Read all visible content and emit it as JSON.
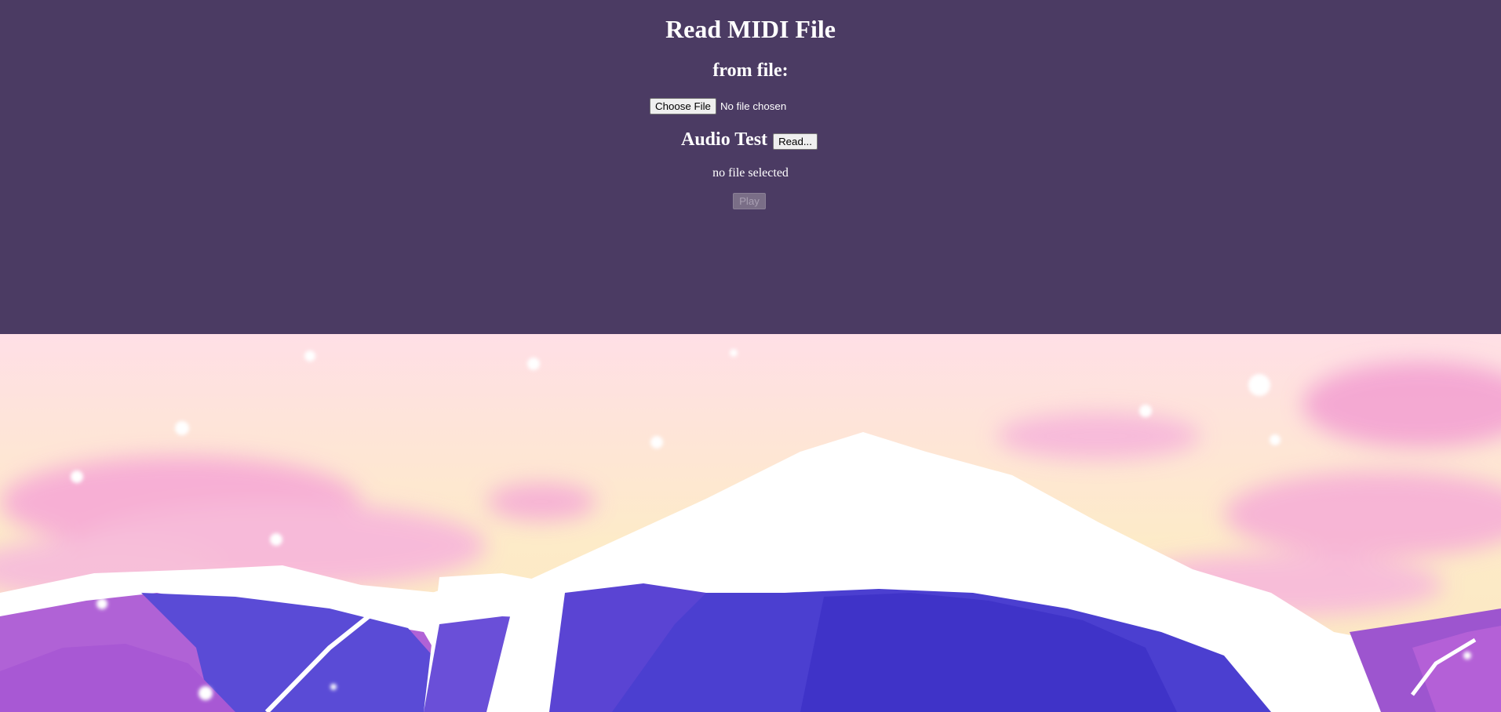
{
  "page": {
    "title": "Read MIDI File"
  },
  "file_input": {
    "heading": "from file:",
    "button_label": "Choose File",
    "status": "No file chosen"
  },
  "audio_test": {
    "label": "Audio Test",
    "read_button_label": "Read...",
    "selection_status": "no file selected",
    "play_button_label": "Play",
    "play_enabled": false
  },
  "colors": {
    "panel_background": "#4b3b63",
    "text": "#ffffff",
    "sky_top": "#ffdfe6",
    "sky_bottom": "#fcebc4",
    "cloud": "#f7a9d8",
    "snow": "#ffffff",
    "mountain_purple": "#a55ad2",
    "mountain_blue": "#4a3fd0"
  },
  "background": {
    "description_icon": "mountain-landscape-image"
  }
}
